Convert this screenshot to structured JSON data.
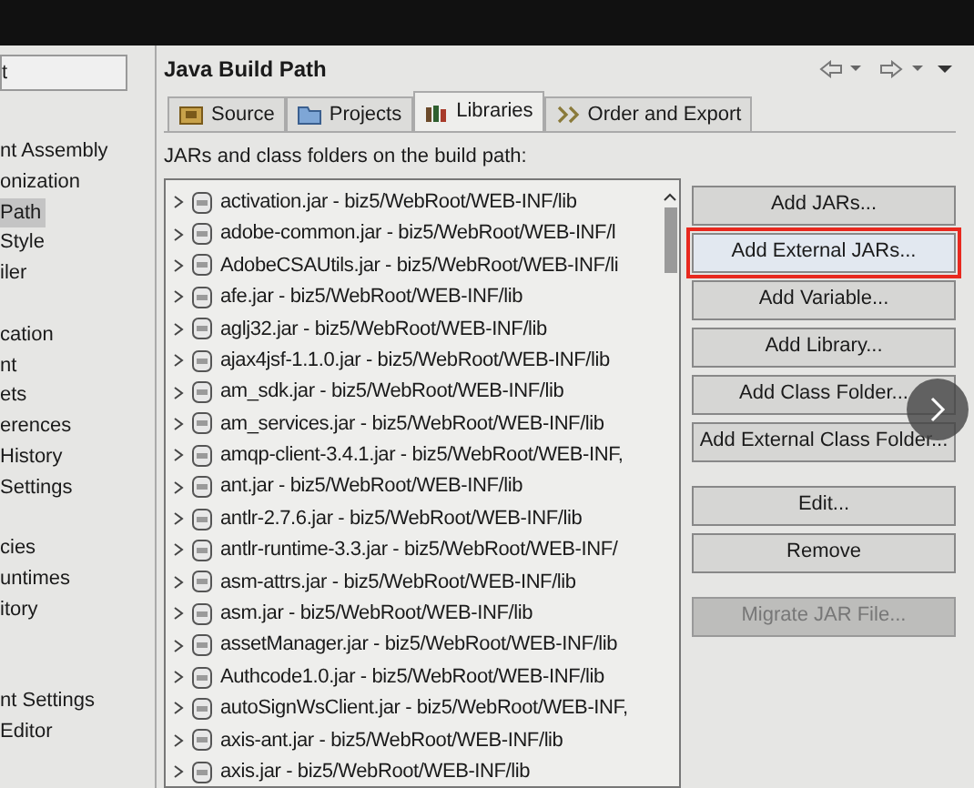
{
  "sidebar": {
    "filter": {
      "value": "t"
    },
    "groups": [
      [
        {
          "label": "nt Assembly",
          "selected": false
        },
        {
          "label": "onization",
          "selected": false
        },
        {
          "label": "Path",
          "selected": true
        },
        {
          "label": "Style",
          "selected": false
        },
        {
          "label": "iler",
          "selected": false
        }
      ],
      [
        {
          "label": "cation",
          "selected": false
        },
        {
          "label": "nt",
          "selected": false
        },
        {
          "label": "ets",
          "selected": false
        },
        {
          "label": "erences",
          "selected": false
        },
        {
          "label": "History",
          "selected": false
        },
        {
          "label": "Settings",
          "selected": false
        }
      ],
      [
        {
          "label": "cies",
          "selected": false
        },
        {
          "label": "untimes",
          "selected": false
        },
        {
          "label": "itory",
          "selected": false
        }
      ],
      [
        {
          "label": "nt Settings",
          "selected": false
        },
        {
          "label": "Editor",
          "selected": false
        }
      ]
    ]
  },
  "page": {
    "title": "Java Build Path",
    "tabs": [
      {
        "label": "Source",
        "kind": "source",
        "selected": false
      },
      {
        "label": "Projects",
        "kind": "projects",
        "selected": false
      },
      {
        "label": "Libraries",
        "kind": "libraries",
        "selected": true
      },
      {
        "label": "Order and Export",
        "kind": "order",
        "selected": false
      }
    ],
    "list_label": "JARs and class folders on the build path:",
    "entries": [
      "activation.jar - biz5/WebRoot/WEB-INF/lib",
      "adobe-common.jar - biz5/WebRoot/WEB-INF/l",
      "AdobeCSAUtils.jar - biz5/WebRoot/WEB-INF/li",
      "afe.jar - biz5/WebRoot/WEB-INF/lib",
      "aglj32.jar - biz5/WebRoot/WEB-INF/lib",
      "ajax4jsf-1.1.0.jar - biz5/WebRoot/WEB-INF/lib",
      "am_sdk.jar - biz5/WebRoot/WEB-INF/lib",
      "am_services.jar - biz5/WebRoot/WEB-INF/lib",
      "amqp-client-3.4.1.jar - biz5/WebRoot/WEB-INF,",
      "ant.jar - biz5/WebRoot/WEB-INF/lib",
      "antlr-2.7.6.jar - biz5/WebRoot/WEB-INF/lib",
      "antlr-runtime-3.3.jar - biz5/WebRoot/WEB-INF/",
      "asm-attrs.jar - biz5/WebRoot/WEB-INF/lib",
      "asm.jar - biz5/WebRoot/WEB-INF/lib",
      "assetManager.jar - biz5/WebRoot/WEB-INF/lib",
      "Authcode1.0.jar - biz5/WebRoot/WEB-INF/lib",
      "autoSignWsClient.jar - biz5/WebRoot/WEB-INF,",
      "axis-ant.jar - biz5/WebRoot/WEB-INF/lib",
      "axis.jar - biz5/WebRoot/WEB-INF/lib"
    ],
    "button_groups": [
      [
        {
          "label": "Add JARs...",
          "highlighted": false,
          "disabled": false
        },
        {
          "label": "Add External JARs...",
          "highlighted": true,
          "disabled": false
        },
        {
          "label": "Add Variable...",
          "highlighted": false,
          "disabled": false
        },
        {
          "label": "Add Library...",
          "highlighted": false,
          "disabled": false
        },
        {
          "label": "Add Class Folder...",
          "highlighted": false,
          "disabled": false
        },
        {
          "label": "Add External Class Folder...",
          "highlighted": false,
          "disabled": false
        }
      ],
      [
        {
          "label": "Edit...",
          "highlighted": false,
          "disabled": false
        },
        {
          "label": "Remove",
          "highlighted": false,
          "disabled": false
        }
      ],
      [
        {
          "label": "Migrate JAR File...",
          "highlighted": false,
          "disabled": true
        }
      ]
    ]
  }
}
